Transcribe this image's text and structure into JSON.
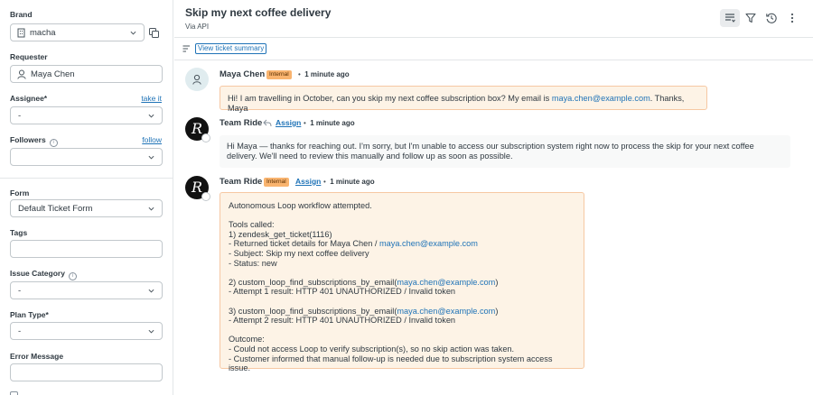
{
  "sidebar": {
    "brand": {
      "label": "Brand",
      "value": "macha"
    },
    "requester": {
      "label": "Requester",
      "value": "Maya Chen"
    },
    "assignee": {
      "label": "Assignee*",
      "link": "take it",
      "value": "-"
    },
    "followers": {
      "label": "Followers",
      "link": "follow",
      "value": ""
    },
    "form": {
      "label": "Form",
      "value": "Default Ticket Form"
    },
    "tags": {
      "label": "Tags",
      "value": ""
    },
    "issue_category": {
      "label": "Issue Category",
      "value": "-"
    },
    "plan_type": {
      "label": "Plan Type*",
      "value": "-"
    },
    "error_message": {
      "label": "Error Message",
      "value": ""
    }
  },
  "header": {
    "title": "Skip my next coffee delivery",
    "subtitle": "Via API",
    "icons": [
      "list-icon",
      "filter-icon",
      "history-icon",
      "more-icon"
    ]
  },
  "summary": {
    "button": "View ticket summary"
  },
  "messages": [
    {
      "author": "Maya Chen",
      "badge": "Internal",
      "time": "1 minute ago",
      "text_before": "Hi! I am travelling in October, can you skip my next coffee subscription box? My email is ",
      "email": "maya.chen@example.com",
      "text_after": ". Thanks, Maya"
    },
    {
      "author": "Team Ride",
      "assign": "Assign",
      "time": "1 minute ago",
      "line1": "Hi Maya — thanks for reaching out. I'm sorry, but I'm unable to access our subscription system right now to process the skip for your next coffee",
      "line2": "delivery. We'll need to review this manually and follow up as soon as possible."
    },
    {
      "author": "Team Ride",
      "badge": "Internal",
      "assign": "Assign",
      "time": "1 minute ago",
      "l1": "Autonomous Loop workflow attempted.",
      "l2": "Tools called:",
      "l3": "1) zendesk_get_ticket(1116)",
      "l4": "- Returned ticket details for Maya Chen / ",
      "l4_email": "maya.chen@example.com",
      "l5": "- Subject: Skip my next coffee delivery",
      "l6": "- Status: new",
      "l7": "2) custom_loop_find_subscriptions_by_email(",
      "l7_email": "maya.chen@example.com",
      "l7_end": ")",
      "l8": "- Attempt 1 result: HTTP 401 UNAUTHORIZED / Invalid token",
      "l9": "3) custom_loop_find_subscriptions_by_email(",
      "l9_email": "maya.chen@example.com",
      "l9_end": ")",
      "l10": "- Attempt 2 result: HTTP 401 UNAUTHORIZED / Invalid token",
      "l11": "Outcome:",
      "l12": "- Could not access Loop to verify subscription(s), so no skip action was taken.",
      "l13": "- Customer informed that manual follow-up is needed due to subscription system access issue."
    }
  ]
}
